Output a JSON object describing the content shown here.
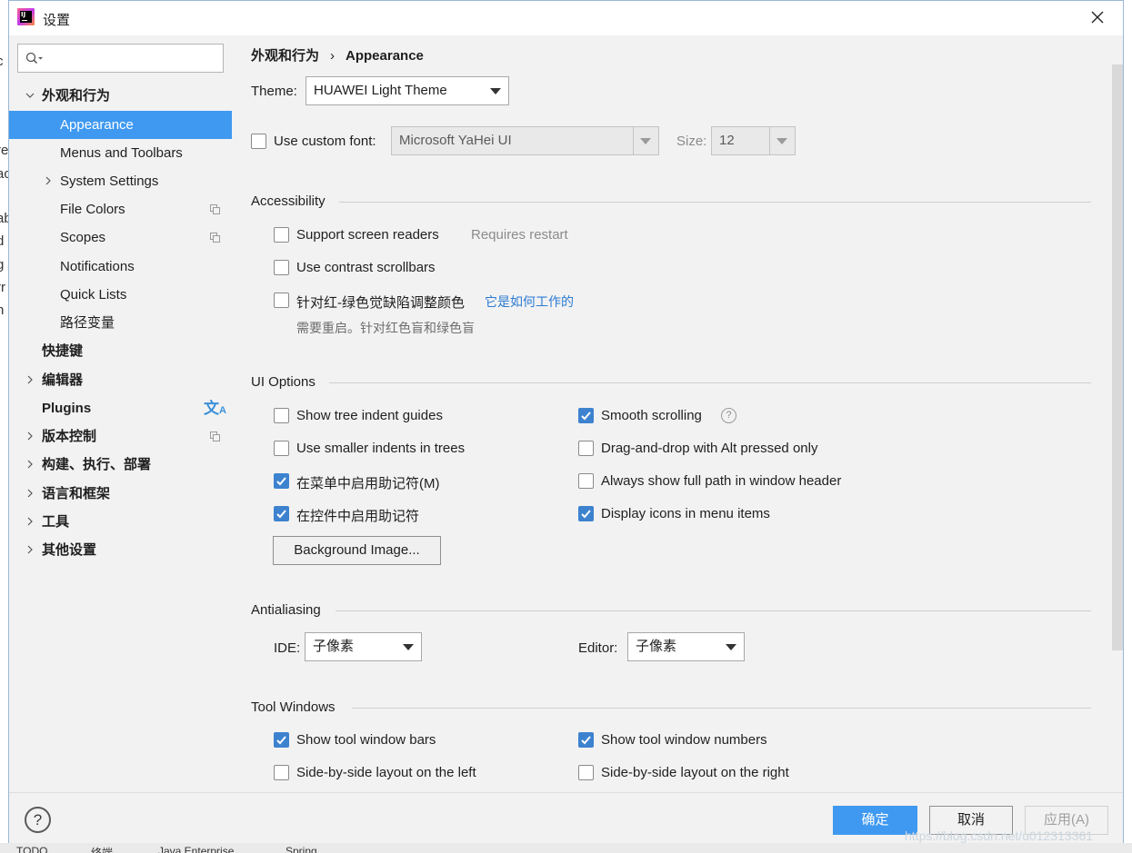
{
  "window": {
    "title": "设置"
  },
  "background": {
    "left_chars": [
      "c",
      "re",
      "ac",
      "ab",
      "d",
      "g",
      "rr",
      "n"
    ],
    "bottom_tabs": [
      "TODO",
      "终端",
      "Java Enterprise",
      "Spring"
    ]
  },
  "search": {
    "placeholder": ""
  },
  "sidebar": {
    "items": [
      {
        "label": "外观和行为",
        "bold": true,
        "expandable": true,
        "expanded": true
      },
      {
        "label": "Appearance",
        "selected": true
      },
      {
        "label": "Menus and Toolbars"
      },
      {
        "label": "System Settings",
        "expandable": true
      },
      {
        "label": "File Colors",
        "project_icon": true
      },
      {
        "label": "Scopes",
        "project_icon": true
      },
      {
        "label": "Notifications"
      },
      {
        "label": "Quick Lists"
      },
      {
        "label": "路径变量"
      },
      {
        "label": "快捷键",
        "bold": true
      },
      {
        "label": "编辑器",
        "bold": true,
        "expandable": true
      },
      {
        "label": "Plugins",
        "bold": true,
        "translate_icon": true
      },
      {
        "label": "版本控制",
        "bold": true,
        "expandable": true,
        "project_icon": true
      },
      {
        "label": "构建、执行、部署",
        "bold": true,
        "expandable": true
      },
      {
        "label": "语言和框架",
        "bold": true,
        "expandable": true
      },
      {
        "label": "工具",
        "bold": true,
        "expandable": true
      },
      {
        "label": "其他设置",
        "bold": true,
        "expandable": true
      }
    ]
  },
  "breadcrumb": {
    "parent": "外观和行为",
    "separator": "›",
    "current": "Appearance"
  },
  "theme": {
    "label": "Theme:",
    "value": "HUAWEI Light Theme"
  },
  "custom_font": {
    "label": "Use custom font:",
    "checked": false,
    "font": "Microsoft YaHei UI",
    "size_label": "Size:",
    "size": "12"
  },
  "accessibility": {
    "title": "Accessibility",
    "screen_readers": {
      "label": "Support screen readers",
      "checked": false,
      "note": "Requires restart"
    },
    "contrast_scrollbars": {
      "label": "Use contrast scrollbars",
      "checked": false
    },
    "color_deficiency": {
      "label": "针对红-绿色觉缺陷调整颜色",
      "checked": false,
      "link": "它是如何工作的",
      "note": "需要重启。针对红色盲和绿色盲"
    }
  },
  "ui_options": {
    "title": "UI Options",
    "left": [
      {
        "label": "Show tree indent guides",
        "checked": false
      },
      {
        "label": "Use smaller indents in trees",
        "checked": false
      },
      {
        "label": "在菜单中启用助记符(M)",
        "checked": true
      },
      {
        "label": "在控件中启用助记符",
        "checked": true
      }
    ],
    "right": [
      {
        "label": "Smooth scrolling",
        "checked": true,
        "help": "?"
      },
      {
        "label": "Drag-and-drop with Alt pressed only",
        "checked": false
      },
      {
        "label": "Always show full path in window header",
        "checked": false
      },
      {
        "label": "Display icons in menu items",
        "checked": true
      }
    ],
    "background_button": "Background Image..."
  },
  "antialiasing": {
    "title": "Antialiasing",
    "ide_label": "IDE:",
    "ide_value": "子像素",
    "editor_label": "Editor:",
    "editor_value": "子像素"
  },
  "tool_windows": {
    "title": "Tool Windows",
    "items": [
      {
        "label": "Show tool window bars",
        "checked": true
      },
      {
        "label": "Show tool window numbers",
        "checked": true
      },
      {
        "label": "Side-by-side layout on the left",
        "checked": false
      },
      {
        "label": "Side-by-side layout on the right",
        "checked": false
      }
    ]
  },
  "footer": {
    "help": "?",
    "ok": "确定",
    "cancel": "取消",
    "apply": "应用(A)"
  },
  "watermark": "https://blog.csdn.net/u012313361",
  "colors": {
    "accent": "#3f99f0",
    "checkbox": "#3d82cf",
    "link": "#2b7bd3"
  }
}
